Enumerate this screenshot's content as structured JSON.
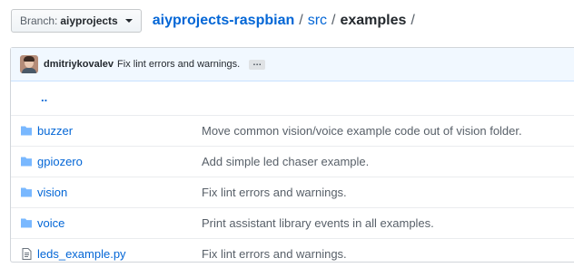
{
  "branch": {
    "label": "Branch:",
    "value": "aiyprojects"
  },
  "breadcrumb": {
    "repo": "aiyprojects-raspbian",
    "sep1": "/",
    "seg1": "src",
    "sep2": "/",
    "current": "examples",
    "sep3": "/"
  },
  "commit": {
    "author": "dmitriykovalev",
    "message": "Fix lint errors and warnings.",
    "ellipsis": "…"
  },
  "parent_dir": "..",
  "files": [
    {
      "type": "folder",
      "name": "buzzer",
      "message": "Move common vision/voice example code out of vision folder."
    },
    {
      "type": "folder",
      "name": "gpiozero",
      "message": "Add simple led chaser example."
    },
    {
      "type": "folder",
      "name": "vision",
      "message": "Fix lint errors and warnings."
    },
    {
      "type": "folder",
      "name": "voice",
      "message": "Print assistant library events in all examples."
    },
    {
      "type": "file",
      "name": "leds_example.py",
      "message": "Fix lint errors and warnings."
    }
  ],
  "colors": {
    "link": "#0366d6",
    "folder_icon": "#79b8ff",
    "file_icon": "#6a737d",
    "commit_bg": "#f1f8ff"
  }
}
